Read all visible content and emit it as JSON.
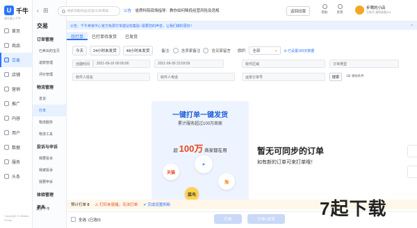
{
  "rail": {
    "brand": "千牛",
    "brand_sub": "和生意上千牛",
    "items": [
      {
        "label": "首页",
        "icon": "home-icon"
      },
      {
        "label": "商品",
        "icon": "goods-icon"
      },
      {
        "label": "交易",
        "icon": "trade-icon"
      },
      {
        "label": "店铺",
        "icon": "shop-icon"
      },
      {
        "label": "营销",
        "icon": "marketing-icon"
      },
      {
        "label": "推广",
        "icon": "promotion-icon"
      },
      {
        "label": "内容",
        "icon": "content-icon"
      },
      {
        "label": "用户",
        "icon": "user-icon"
      },
      {
        "label": "数据",
        "icon": "data-icon"
      },
      {
        "label": "服务",
        "icon": "service-icon"
      },
      {
        "label": "头条",
        "icon": "headline-icon"
      }
    ],
    "footer": "Copyright © Alibaba Group"
  },
  "submenu": {
    "title": "交易",
    "groups": [
      {
        "label": "订单管理",
        "items": [
          "已卖出的宝贝",
          "退款管理",
          "评价管理"
        ]
      },
      {
        "label": "物流管理",
        "items": [
          "发货",
          "打单",
          "物流服务",
          "物流工具"
        ]
      },
      {
        "label": "投诉与申诉",
        "items": [
          "我要投诉",
          "我被投诉",
          "我要申诉"
        ]
      },
      {
        "label": "体验管理",
        "items": []
      },
      {
        "label": "更多",
        "items": []
      }
    ],
    "active_item": "打单",
    "foot": "关于千牛"
  },
  "topbar": {
    "search_placeholder": "搜索功能/商品/答案/头条/帮助",
    "announce_tag": "公告",
    "announce_text": "省质科院现场指导：教你如何降低经营风险及违规",
    "back_label": "返回旧版",
    "help_label": "帮助",
    "feedback_label": "反馈",
    "more_label": "消息",
    "store_name": "步莺的小店",
    "store_sub": "主账号 通知查看001"
  },
  "notice": {
    "text": "公告：千牛卖家中心官方免费打单建议收集贴~需要您的声音，让我们做的更好！",
    "close": "×"
  },
  "tabs": [
    "待打单",
    "已打单待发货",
    "已发货"
  ],
  "filters": {
    "time_opts": [
      "今天",
      "24小时未发货",
      "48小时未发货"
    ],
    "remark_label": "备注:",
    "opt_seller_remark": "含卖家备注",
    "opt_buyer_msg": "含买家留言",
    "flag_label": "旗帜:",
    "flag_value": "全部",
    "advanced_link": "⊘ 已设置160天数据",
    "created_label": "创建时间",
    "date_start": "2021-09-16 00:00:00",
    "date_end": "2021-09-30 23:59:59",
    "region_placeholder": "收件区域",
    "row2_left": "订单类型",
    "row3": [
      "收件人姓名",
      "收件人电话",
      "运单订单号"
    ],
    "search_btn": "搜索",
    "clear_link": "清除条件"
  },
  "promo": {
    "headline": "一键打单一键发货",
    "subline": "累计服务超过100万商家",
    "big_prefix": "超",
    "big_number": "100万",
    "big_suffix": "商家都在用",
    "apps": [
      "天猫",
      "淘",
      "菜鸟"
    ]
  },
  "empty": {
    "title": "暂无可同步的订单",
    "sub": "如有新的订单可来打单哦！"
  },
  "pending": {
    "label": "预计打单",
    "count": "0",
    "error": "打印未就绪，无法打单",
    "ok": "完成设置刷新"
  },
  "footer": {
    "select_all": "全选",
    "selected": "(已选0)",
    "btn_print": "打单",
    "btn_print_ship": "打单+发货"
  },
  "watermark": "7起下载",
  "colors": {
    "accent": "#2b74ff",
    "warn": "#e8461e",
    "notice_bg": "#eaf2ff"
  }
}
